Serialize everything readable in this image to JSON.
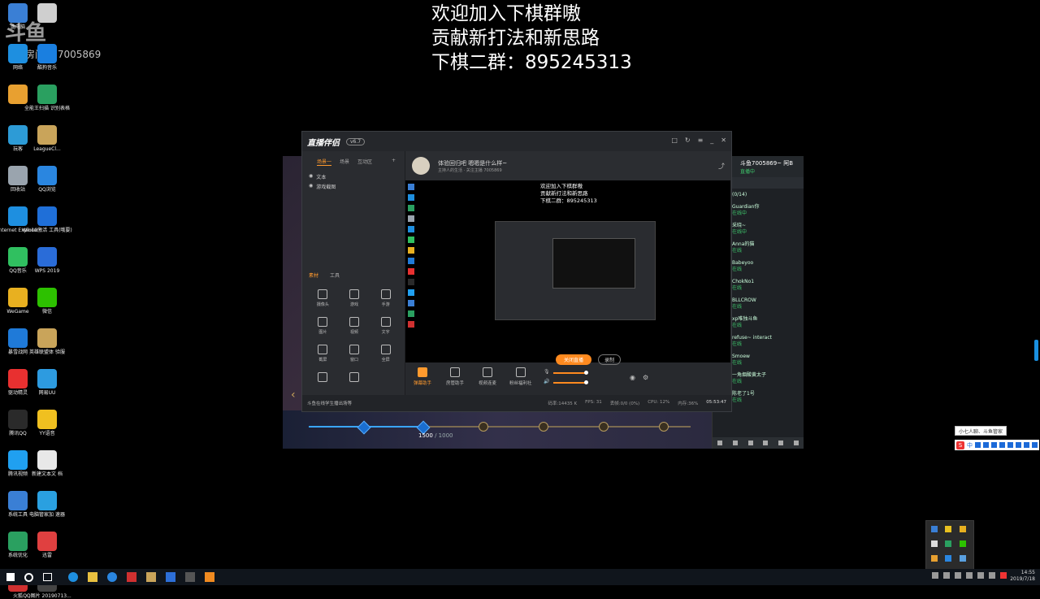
{
  "overlay": {
    "line1": "欢迎加入下棋群嗷",
    "line2": "贡献新打法和新思路",
    "line3": "下棋二群：895245313"
  },
  "watermark": {
    "logo": "斗鱼",
    "room_prefix": "房间号",
    "room_id": "7005869"
  },
  "desktop_icons": [
    {
      "label": "此电脑",
      "icon": "computer-icon",
      "color": "#3a7fd5"
    },
    {
      "label": "",
      "icon": "document-icon",
      "color": "#cfcfcf"
    },
    {
      "label": "网络",
      "icon": "ie-icon",
      "color": "#1e8fe0"
    },
    {
      "label": "酷狗音乐",
      "icon": "kugou-icon",
      "color": "#1a7fe0"
    },
    {
      "label": "",
      "icon": "app-icon",
      "color": "#e8a030"
    },
    {
      "label": "全能王扫描\n识别表格",
      "icon": "scanner-icon",
      "color": "#2aa060"
    },
    {
      "label": "玩客",
      "icon": "wanke-icon",
      "color": "#2d9bd6"
    },
    {
      "label": "LeagueCl...",
      "icon": "lol-icon",
      "color": "#c9a45a"
    },
    {
      "label": "回收站",
      "icon": "recycle-bin-icon",
      "color": "#9aa4ae"
    },
    {
      "label": "QQ浏览",
      "icon": "qq-browser-icon",
      "color": "#2a86e0"
    },
    {
      "label": "Internet\nExplorer",
      "icon": "ie-icon",
      "color": "#1e8fe0"
    },
    {
      "label": "Win10激活\n工具(哦要)",
      "icon": "windows-icon",
      "color": "#1f6fd8"
    },
    {
      "label": "QQ音乐",
      "icon": "qq-music-icon",
      "color": "#30c060"
    },
    {
      "label": "WPS 2019",
      "icon": "wps-icon",
      "color": "#2a6cd8"
    },
    {
      "label": "WeGame",
      "icon": "wegame-icon",
      "color": "#e8b020"
    },
    {
      "label": "微信",
      "icon": "wechat-icon",
      "color": "#2dc100"
    },
    {
      "label": "暴雪战网",
      "icon": "battlenet-icon",
      "color": "#1f7ad8"
    },
    {
      "label": "英雄联盟体\n验服",
      "icon": "lol-icon",
      "color": "#c9a45a"
    },
    {
      "label": "驱动精灵",
      "icon": "driver-icon",
      "color": "#e83030"
    },
    {
      "label": "网易UU",
      "icon": "uu-icon",
      "color": "#2d9be0"
    },
    {
      "label": "腾讯QQ",
      "icon": "qq-icon",
      "color": "#2a2a2a"
    },
    {
      "label": "YY语音",
      "icon": "yy-icon",
      "color": "#f0c020"
    },
    {
      "label": "腾讯视频",
      "icon": "video-icon",
      "color": "#20a0f0"
    },
    {
      "label": "新建文本文\n档",
      "icon": "text-file-icon",
      "color": "#e8e8e8"
    },
    {
      "label": "系统工具",
      "icon": "tool-icon",
      "color": "#3a7fd5"
    },
    {
      "label": "电脑管家加\n速器",
      "icon": "refresh-icon",
      "color": "#2aa0e0"
    },
    {
      "label": "系统优化",
      "icon": "optimize-icon",
      "color": "#2aa060"
    },
    {
      "label": "迅雷",
      "icon": "thunder-icon",
      "color": "#e04040"
    },
    {
      "label": "火狐",
      "icon": "game-icon",
      "color": "#d03030"
    },
    {
      "label": "QQ图片\n20190713...",
      "icon": "image-icon",
      "color": "#444"
    }
  ],
  "app": {
    "logo": "直播伴侣",
    "version": "v6.7",
    "tabs": [
      "场景一",
      "场景",
      "互动区"
    ],
    "sources": [
      "文本",
      "游戏截图"
    ],
    "tool_tabs": [
      "素材",
      "工具"
    ],
    "tools": [
      "摄像头",
      "游戏",
      "手游",
      "图片",
      "视频",
      "文字",
      "截屏",
      "窗口",
      "全屏",
      "",
      ""
    ],
    "room_title": "体验回归吧 嗯嗯是什么样~",
    "room_sub": "主持人的生活 · 关注主播  7005869",
    "preview_text": [
      "欢迎加入下棋群嗷",
      "贡献新打法和新思路",
      "下棋二群：895245313"
    ],
    "bottom_btns": [
      "弹幕助手",
      "房管助手",
      "视频连麦",
      "粉丝福利社"
    ],
    "live_btn": "关闭直播",
    "rec_btn": "录制",
    "notice": "斗鱼在线学生播出场等",
    "stats": [
      "码率:14435 K",
      "FPS: 31",
      "丢帧:0/0 (0%)",
      "CPU: 12%",
      "内存:36%"
    ],
    "clock": "05:53:47"
  },
  "game": {
    "progress_current": "1500",
    "progress_total": "1000"
  },
  "chat": {
    "user": "斗鱼7005869~ 阿B",
    "status": "直播中",
    "count": "(0/14)",
    "items": [
      {
        "name": "Guardian你",
        "state": "在线中"
      },
      {
        "name": "采晓~",
        "state": "在线中"
      },
      {
        "name": "Anna的猫",
        "state": "在线"
      },
      {
        "name": "Babeyoo",
        "state": "在线"
      },
      {
        "name": "ChokNo1",
        "state": "在线"
      },
      {
        "name": "BLLCROW",
        "state": "在线"
      },
      {
        "name": "xp唯独斗鱼",
        "state": "在线"
      },
      {
        "name": "refuse~ interact",
        "state": "在线"
      },
      {
        "name": "Smoew",
        "state": "在线"
      },
      {
        "name": "一角烟酸黄太子",
        "state": "在线"
      },
      {
        "name": "陈老了1号",
        "state": "在线"
      }
    ]
  },
  "ime": {
    "tooltip": "小七人聊、斗鱼管家",
    "mode": "中"
  },
  "clock": {
    "time": "14:55",
    "date": "2019/7/18"
  }
}
